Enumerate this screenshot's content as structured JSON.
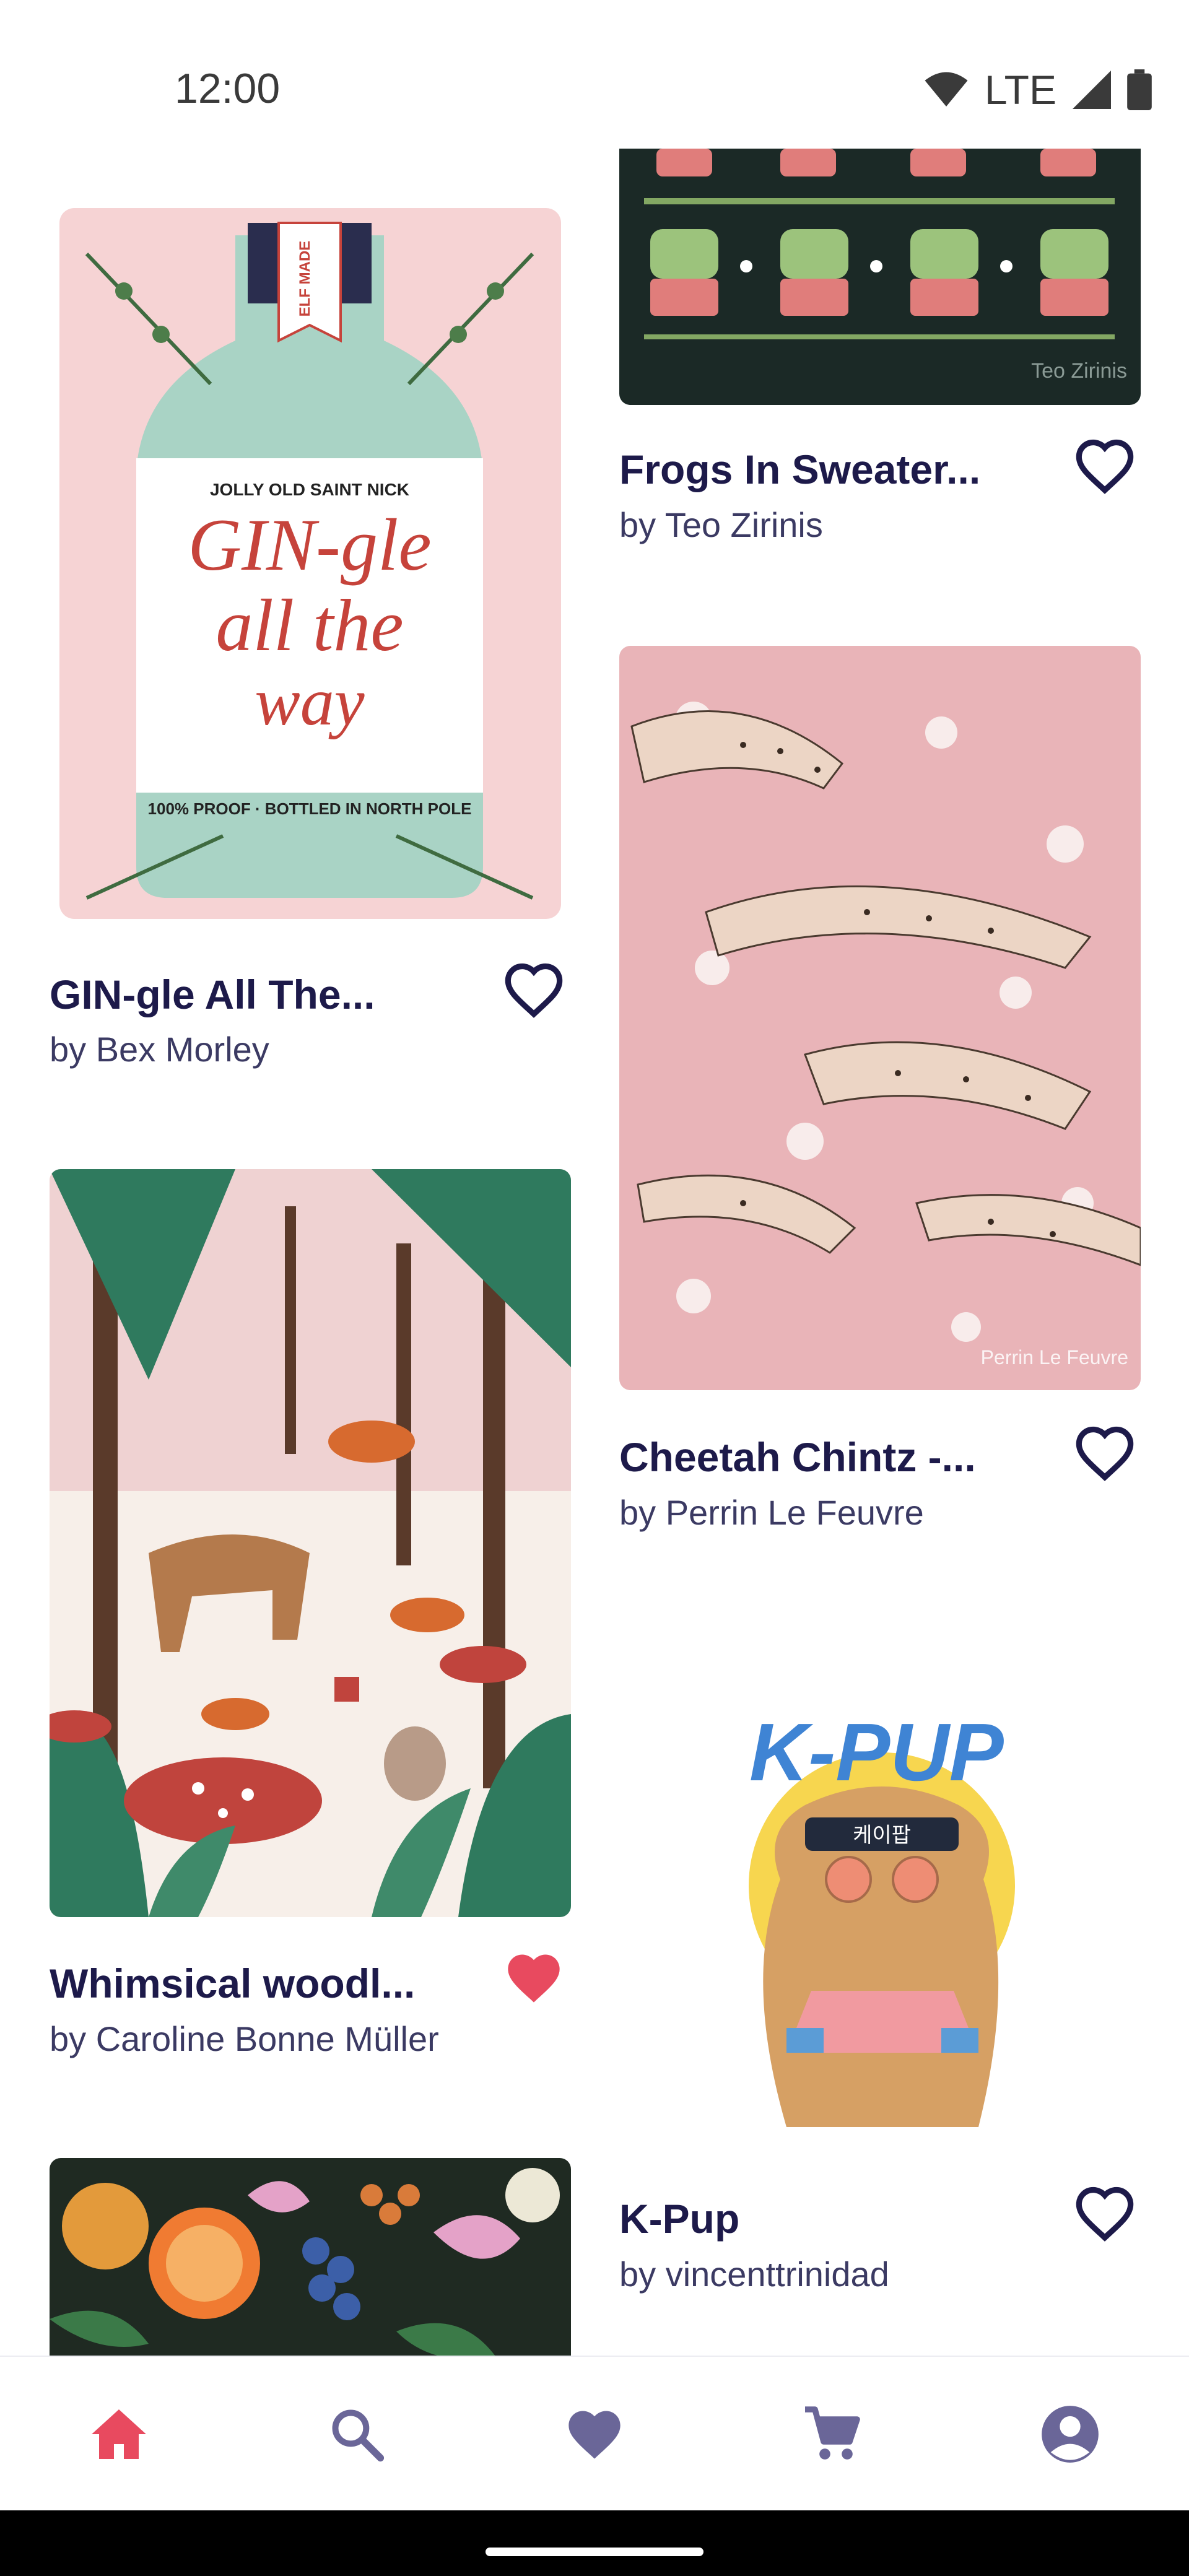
{
  "status_bar": {
    "time": "12:00",
    "network": "LTE"
  },
  "feed": {
    "items": [
      {
        "title": "Frogs In Sweater...",
        "artist": "by Teo Zirinis",
        "favorited": false,
        "art_signature": "Teo Zirinis"
      },
      {
        "title": "GIN-gle All The...",
        "artist": "by Bex Morley",
        "favorited": false
      },
      {
        "title": "Cheetah Chintz -...",
        "artist": "by Perrin Le Feuvre",
        "favorited": false,
        "art_signature": "Perrin Le Feuvre"
      },
      {
        "title": "Whimsical woodl...",
        "artist": "by Caroline Bonne Müller",
        "favorited": true
      },
      {
        "title": "K-Pup",
        "artist": "by vincenttrinidad",
        "favorited": false
      },
      {
        "title": "",
        "artist": "",
        "favorited": false
      }
    ]
  },
  "artwork_text": {
    "gin": {
      "label": "ELF MADE",
      "top": "JOLLY OLD   SAINT NICK",
      "line1": "GIN-gle",
      "line2": "all the",
      "line3": "way",
      "bottom": "100% PROOF · BOTTLED IN NORTH POLE"
    },
    "kpup": {
      "logo": "K-PUP",
      "band": "케이팝"
    }
  },
  "bottom_nav": [
    {
      "icon": "home-icon",
      "active": true
    },
    {
      "icon": "search-icon",
      "active": false
    },
    {
      "icon": "heart-icon",
      "active": false
    },
    {
      "icon": "cart-icon",
      "active": false
    },
    {
      "icon": "account-icon",
      "active": false
    }
  ],
  "colors": {
    "accent": "#e84a5f",
    "nav_inactive": "#6a6698",
    "title": "#1d1a4a",
    "heart_outline": "#1d1a4a"
  }
}
